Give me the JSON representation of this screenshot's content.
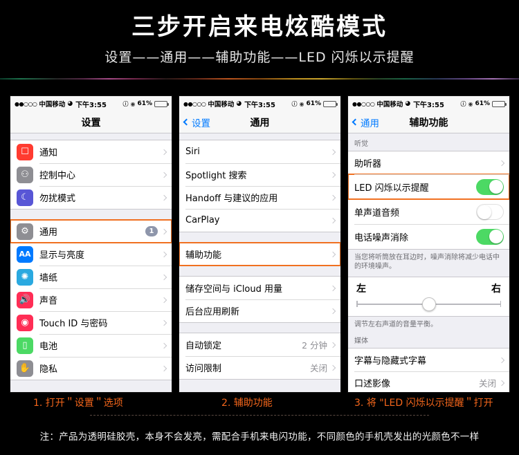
{
  "header": {
    "title": "三步开启来电炫酷模式",
    "subtitle": "设置——通用——辅助功能——LED 闪烁以示提醒",
    "accent_color": "#f4661b",
    "background_color": "#000000"
  },
  "statusbar": {
    "signal_dots": "●●○○○",
    "carrier": "中国移动",
    "wifi_icon": "wifi-icon",
    "time": "下午3:55",
    "alarm_icon": "alarm-icon",
    "lock_icon": "rotation-lock-icon",
    "battery_percent": "61%",
    "battery_level": 61
  },
  "phone1": {
    "nav": {
      "title": "设置",
      "back_label": ""
    },
    "groups": [
      {
        "rows": [
          {
            "icon": "notifications-icon",
            "icon_class": "ic-notif",
            "glyph": "▣",
            "label": "通知",
            "value": "",
            "chevron": true,
            "badge": ""
          },
          {
            "icon": "control-center-icon",
            "icon_class": "ic-cc",
            "glyph": "⦿",
            "label": "控制中心",
            "value": "",
            "chevron": true,
            "badge": ""
          },
          {
            "icon": "do-not-disturb-icon",
            "icon_class": "ic-dnd",
            "glyph": "☾",
            "label": "勿扰模式",
            "value": "",
            "chevron": true,
            "badge": ""
          }
        ]
      },
      {
        "rows": [
          {
            "icon": "general-gear-icon",
            "icon_class": "ic-gen",
            "glyph": "⚙",
            "label": "通用",
            "value": "",
            "chevron": true,
            "badge": "1",
            "highlighted": true
          },
          {
            "icon": "display-brightness-icon",
            "icon_class": "ic-disp",
            "glyph": "AA",
            "label": "显示与亮度",
            "value": "",
            "chevron": true,
            "badge": ""
          },
          {
            "icon": "wallpaper-icon",
            "icon_class": "ic-wall",
            "glyph": "✾",
            "label": "墙纸",
            "value": "",
            "chevron": true,
            "badge": ""
          },
          {
            "icon": "sound-icon",
            "icon_class": "ic-sound",
            "glyph": "🔊",
            "label": "声音",
            "value": "",
            "chevron": true,
            "badge": ""
          },
          {
            "icon": "touchid-icon",
            "icon_class": "ic-touch",
            "glyph": "◉",
            "label": "Touch ID 与密码",
            "value": "",
            "chevron": true,
            "badge": ""
          },
          {
            "icon": "battery-icon",
            "icon_class": "ic-batt",
            "glyph": "▭",
            "label": "电池",
            "value": "",
            "chevron": true,
            "badge": ""
          },
          {
            "icon": "privacy-hand-icon",
            "icon_class": "ic-priv",
            "glyph": "✋",
            "label": "隐私",
            "value": "",
            "chevron": true,
            "badge": ""
          }
        ]
      }
    ]
  },
  "phone2": {
    "nav": {
      "back_label": "设置",
      "title": "通用"
    },
    "groups": [
      {
        "rows": [
          {
            "label": "Siri",
            "value": "",
            "chevron": true
          },
          {
            "label": "Spotlight 搜索",
            "value": "",
            "chevron": true
          },
          {
            "label": "Handoff 与建议的应用",
            "value": "",
            "chevron": true
          },
          {
            "label": "CarPlay",
            "value": "",
            "chevron": true
          }
        ]
      },
      {
        "rows": [
          {
            "label": "辅助功能",
            "value": "",
            "chevron": true,
            "highlighted": true
          }
        ]
      },
      {
        "rows": [
          {
            "label": "储存空间与 iCloud 用量",
            "value": "",
            "chevron": true
          },
          {
            "label": "后台应用刷新",
            "value": "",
            "chevron": true
          }
        ]
      },
      {
        "rows": [
          {
            "label": "自动锁定",
            "value": "2 分钟",
            "chevron": true
          },
          {
            "label": "访问限制",
            "value": "关闭",
            "chevron": true
          }
        ]
      }
    ]
  },
  "phone3": {
    "nav": {
      "back_label": "通用",
      "title": "辅助功能"
    },
    "section_hearing": "听觉",
    "hearing_rows": [
      {
        "label": "助听器",
        "type": "chevron",
        "value": ""
      },
      {
        "label": "LED 闪烁以示提醒",
        "type": "toggle",
        "toggle_on": true,
        "highlighted": true
      },
      {
        "label": "单声道音频",
        "type": "toggle",
        "toggle_on": false
      },
      {
        "label": "电话噪声消除",
        "type": "toggle",
        "toggle_on": true
      }
    ],
    "noise_footnote": "当您将听筒放在耳边时，噪声消除将减少电话中的环境噪声。",
    "balance": {
      "left_label": "左",
      "right_label": "右",
      "position_percent": 50
    },
    "balance_footnote": "调节左右声道的音量平衡。",
    "section_media": "媒体",
    "media_rows": [
      {
        "label": "字幕与隐藏式字幕",
        "value": "",
        "chevron": true
      },
      {
        "label": "口述影像",
        "value": "关闭",
        "chevron": true
      }
    ]
  },
  "captions": {
    "step1": "1.  打开＂设置＂选项",
    "step2": "2.  辅助功能",
    "step3": "3.  将 \"LED 闪烁以示提醒＂打开"
  },
  "note": "注：产品为透明硅胶壳，本身不会发亮，需配合手机来电闪功能，不同颜色的手机壳发出的光颜色不一样"
}
